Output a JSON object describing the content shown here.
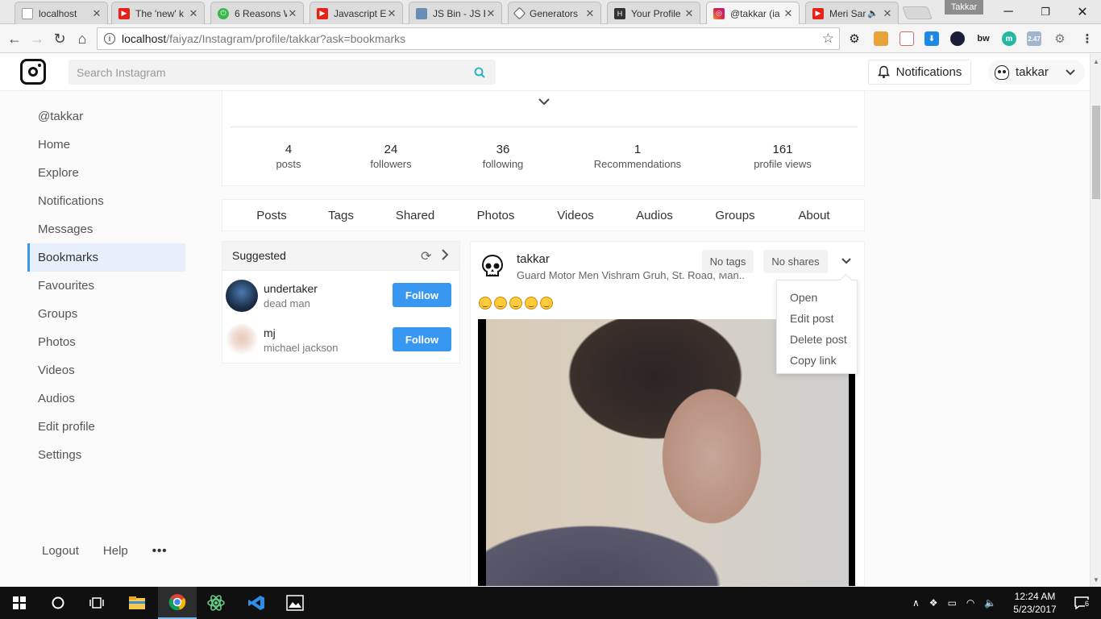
{
  "browser": {
    "tabs": [
      {
        "title": "localhost",
        "icon": "page-icon",
        "color": "#9e9e9e"
      },
      {
        "title": "The 'new' k",
        "icon": "youtube-icon",
        "color": "#e62117"
      },
      {
        "title": "6 Reasons W",
        "icon": "green-power-icon",
        "color": "#3bb84a"
      },
      {
        "title": "Javascript E",
        "icon": "youtube-icon",
        "color": "#e62117"
      },
      {
        "title": "JS Bin - JS E",
        "icon": "jsbin-icon",
        "color": "#6a8db3"
      },
      {
        "title": "Generators",
        "icon": "codepen-icon",
        "color": "#555555"
      },
      {
        "title": "Your Profile",
        "icon": "hashnode-icon",
        "color": "#333333"
      },
      {
        "title": "@takkar (ia",
        "icon": "instagram-icon",
        "color": "#c13584"
      },
      {
        "title": "Meri Sar",
        "icon": "youtube-icon",
        "color": "#e62117"
      }
    ],
    "profile_label": "Takkar",
    "url_host": "localhost",
    "url_path": "/faiyaz/Instagram/profile/takkar?ask=bookmarks",
    "extension_badge": "2.47"
  },
  "header": {
    "search_placeholder": "Search Instagram",
    "notifications_label": "Notifications",
    "username": "takkar"
  },
  "sidebar": {
    "handle": "@takkar",
    "items": [
      "Home",
      "Explore",
      "Notifications",
      "Messages",
      "Bookmarks",
      "Favourites",
      "Groups",
      "Photos",
      "Videos",
      "Audios",
      "Edit profile",
      "Settings"
    ],
    "active": "Bookmarks",
    "footer": {
      "logout": "Logout",
      "help": "Help",
      "more": "•••"
    }
  },
  "stats": [
    {
      "value": "4",
      "label": "posts"
    },
    {
      "value": "24",
      "label": "followers"
    },
    {
      "value": "36",
      "label": "following"
    },
    {
      "value": "1",
      "label": "Recommendations"
    },
    {
      "value": "161",
      "label": "profile views"
    }
  ],
  "profile_tabs": [
    "Posts",
    "Tags",
    "Shared",
    "Photos",
    "Videos",
    "Audios",
    "Groups",
    "About"
  ],
  "suggested": {
    "title": "Suggested",
    "follow_label": "Follow",
    "users": [
      {
        "name": "undertaker",
        "subtitle": "dead man"
      },
      {
        "name": "mj",
        "subtitle": "michael jackson"
      }
    ]
  },
  "post": {
    "username": "takkar",
    "location": "Guard Motor Men Vishram Gruh, St. Road, Man..",
    "tags_label": "No tags",
    "shares_label": "No shares",
    "menu": [
      "Open",
      "Edit post",
      "Delete post",
      "Copy link"
    ]
  },
  "taskbar": {
    "time": "12:24 AM",
    "date": "5/23/2017",
    "notification_count": "6"
  }
}
